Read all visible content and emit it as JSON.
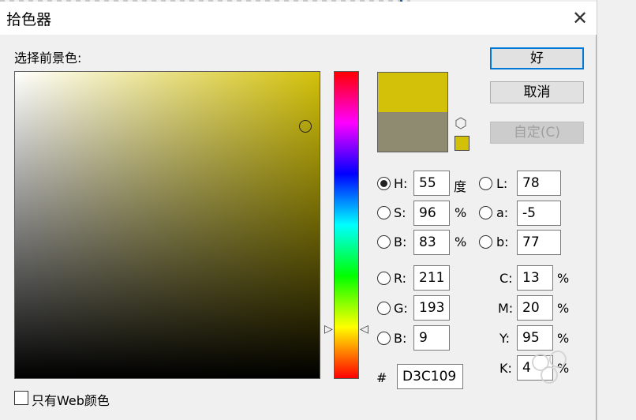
{
  "dialog": {
    "title": "拾色器",
    "close_glyph": "✕",
    "foreground_label": "选择前景色:"
  },
  "buttons": {
    "ok": "好",
    "cancel": "取消",
    "custom": "自定(C)"
  },
  "colors": {
    "new_color": "#d3c109",
    "current_color": "#8f8b70"
  },
  "hsb": {
    "h": {
      "label": "H:",
      "value": "55",
      "unit": "度",
      "selected": true
    },
    "s": {
      "label": "S:",
      "value": "96",
      "unit": "%",
      "selected": false
    },
    "b": {
      "label": "B:",
      "value": "83",
      "unit": "%",
      "selected": false
    }
  },
  "lab": {
    "l": {
      "label": "L:",
      "value": "78"
    },
    "a": {
      "label": "a:",
      "value": "-5"
    },
    "b": {
      "label": "b:",
      "value": "77"
    }
  },
  "rgb": {
    "r": {
      "label": "R:",
      "value": "211"
    },
    "g": {
      "label": "G:",
      "value": "193"
    },
    "b": {
      "label": "B:",
      "value": "9"
    }
  },
  "cmyk": {
    "c": {
      "label": "C:",
      "value": "13",
      "unit": "%"
    },
    "m": {
      "label": "M:",
      "value": "20",
      "unit": "%"
    },
    "y": {
      "label": "Y:",
      "value": "95",
      "unit": "%"
    },
    "k": {
      "label": "K:",
      "value": "4",
      "unit": "%"
    }
  },
  "hex": {
    "label": "#",
    "value": "D3C109"
  },
  "web_only": {
    "label": "只有Web颜色",
    "checked": false
  }
}
